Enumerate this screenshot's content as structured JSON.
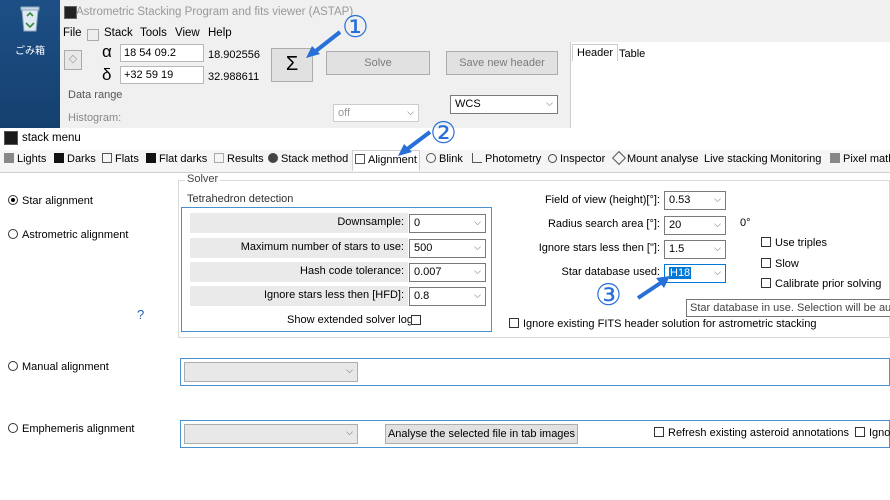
{
  "desktop": {
    "recycle_bin_label": "ごみ箱"
  },
  "astap": {
    "title": "Astrometric Stacking Program and fits viewer (ASTAP)",
    "menu": [
      "File",
      "Stack",
      "Tools",
      "View",
      "Help"
    ],
    "alpha_symbol": "α",
    "delta_symbol": "δ",
    "ra_value": "18 54 09.2",
    "dec_value": "+32 59 19",
    "ra_decimal": "18.902556",
    "dec_decimal": "32.988611",
    "sigma_label": "Σ",
    "solve_label": "Solve",
    "save_header_label": "Save new header",
    "header_tabs": [
      "Header",
      "Table"
    ],
    "data_range_label": "Data range",
    "histogram_label": "Histogram:",
    "off_value": "off",
    "wcs_value": "WCS"
  },
  "annotations": {
    "one": "①",
    "two": "②",
    "three": "③"
  },
  "stack_menu": {
    "title": "stack menu",
    "tabs": [
      "Lights",
      "Darks",
      "Flats",
      "Flat darks",
      "Results",
      "Stack method",
      "Alignment",
      "Blink",
      "Photometry",
      "Inspector",
      "Mount analyse",
      "Live stacking",
      "Monitoring",
      "Pixel math"
    ],
    "alignment": {
      "star_alignment": "Star alignment",
      "astrometric_alignment": "Astrometric alignment",
      "help_mark": "?",
      "manual_alignment": "Manual alignment",
      "ephemeris_alignment": "Emphemeris alignment",
      "solver_group": "Solver",
      "tetra_group": "Tetrahedron detection",
      "downsample_label": "Downsample:",
      "downsample_value": "0",
      "max_stars_label": "Maximum number of stars to use:",
      "max_stars_value": "500",
      "hash_tol_label": "Hash code tolerance:",
      "hash_tol_value": "0.007",
      "ignore_hfd_label": "Ignore stars less then [HFD]:",
      "ignore_hfd_value": "0.8",
      "show_log_label": "Show extended solver log",
      "fov_label": "Field of view (height)[°]:",
      "fov_value": "0.53",
      "radius_label": "Radius search area  [°]:",
      "radius_value": "20",
      "radius_unit": "0°",
      "ignore_arcsec_label": "Ignore stars less then [\"]:",
      "ignore_arcsec_value": "1.5",
      "star_db_label": "Star database used:",
      "star_db_value": "H18",
      "use_triples": "Use triples",
      "slow": "Slow",
      "calibrate_prior": "Calibrate prior solving",
      "tooltip": "Star database in use.  Selection will be automatic",
      "ignore_fits": "Ignore existing FITS header solution for astrometric stacking",
      "analyse_button": "Analyse the selected file in tab images",
      "refresh_asteroid": "Refresh existing asteroid annotations",
      "ignore_truncated": "Igno"
    }
  },
  "colors": {
    "annotation": "#2870d8",
    "focus_border": "#4a8fd0",
    "selection": "#0078d7"
  }
}
